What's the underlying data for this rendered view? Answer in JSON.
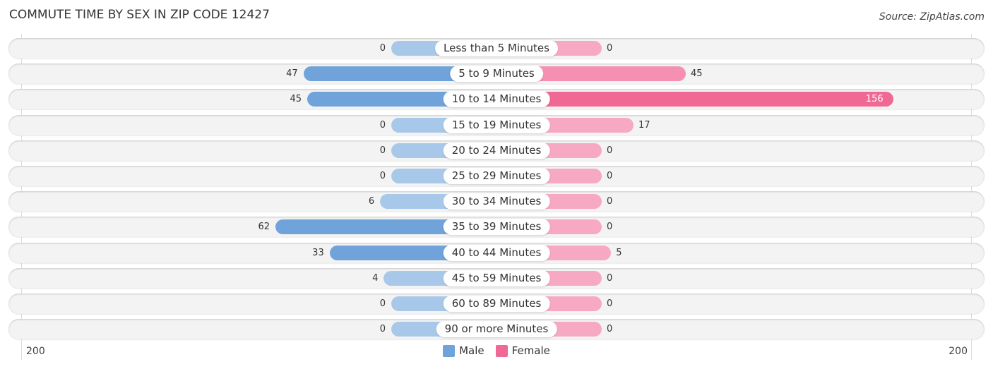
{
  "title": "COMMUTE TIME BY SEX IN ZIP CODE 12427",
  "source": "Source: ZipAtlas.com",
  "colors": {
    "male": "#6fa3da",
    "female": "#f06994"
  },
  "chart_data": {
    "type": "bar",
    "orientation": "horizontal-diverging",
    "title": "COMMUTE TIME BY SEX IN ZIP CODE 12427",
    "categories": [
      "Less than 5 Minutes",
      "5 to 9 Minutes",
      "10 to 14 Minutes",
      "15 to 19 Minutes",
      "20 to 24 Minutes",
      "25 to 29 Minutes",
      "30 to 34 Minutes",
      "35 to 39 Minutes",
      "40 to 44 Minutes",
      "45 to 59 Minutes",
      "60 to 89 Minutes",
      "90 or more Minutes"
    ],
    "series": [
      {
        "name": "Male",
        "values": [
          0,
          47,
          45,
          0,
          0,
          0,
          6,
          62,
          33,
          4,
          0,
          0
        ]
      },
      {
        "name": "Female",
        "values": [
          0,
          45,
          156,
          17,
          0,
          0,
          0,
          0,
          5,
          0,
          0,
          0
        ]
      }
    ],
    "xlim": [
      -200,
      200
    ],
    "axis_labels": {
      "left": "200",
      "right": "200"
    },
    "legend": {
      "position": "bottom-center",
      "entries": [
        "Male",
        "Female"
      ]
    },
    "grid": false
  }
}
